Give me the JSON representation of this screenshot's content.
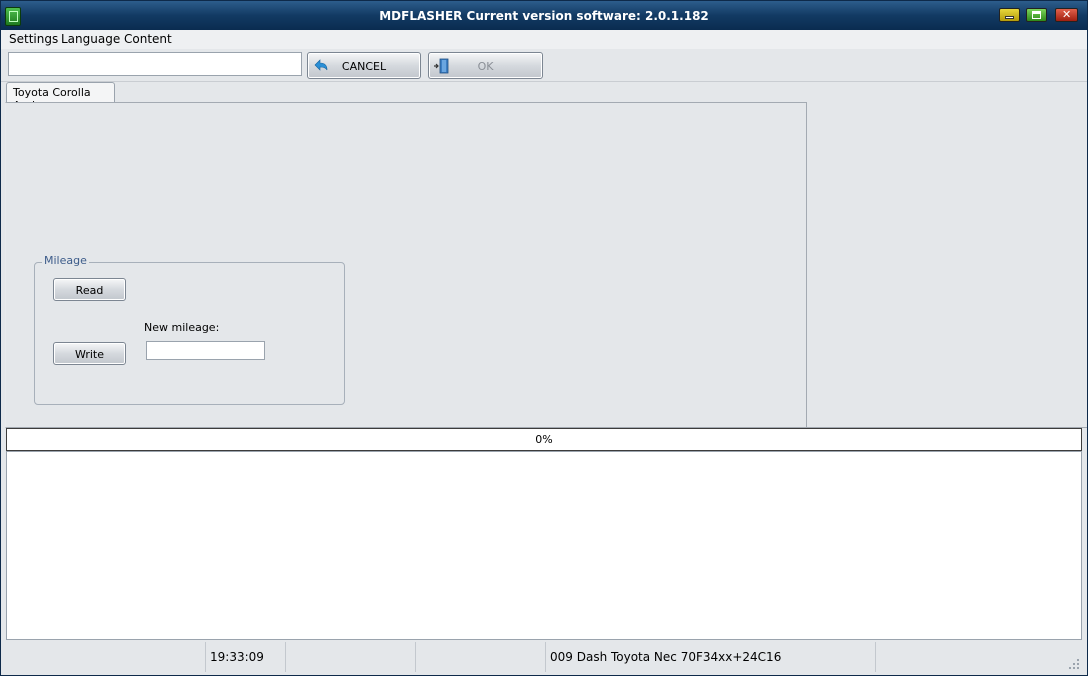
{
  "window": {
    "title": "MDFLASHER  Current version software: 2.0.1.182",
    "controls": [
      "minimize-icon",
      "maximize-icon",
      "close-icon"
    ]
  },
  "menu": {
    "items": [
      {
        "label": "Settings"
      },
      {
        "label": "Language"
      },
      {
        "label": "Content"
      }
    ]
  },
  "toolbar": {
    "input_value": "",
    "cancel_label": "CANCEL",
    "ok_label": "OK",
    "ok_enabled": false
  },
  "tabs": [
    {
      "label": "Toyota Corolla Auris",
      "active": true
    }
  ],
  "mileage": {
    "group_title": "Mileage",
    "read_label": "Read",
    "write_label": "Write",
    "new_mileage_label": "New mileage:",
    "new_mileage_value": ""
  },
  "progress": {
    "percent": 0,
    "text": "0%"
  },
  "log": {
    "lines": []
  },
  "status": {
    "time": "19:33:09",
    "device": "009 Dash Toyota Nec 70F34xx+24C16"
  },
  "colors": {
    "titlebar": "#123a63",
    "window_bg": "#e4e7ea",
    "group_title": "#3d5c8a",
    "progress_fill": "#3c8c3c"
  }
}
